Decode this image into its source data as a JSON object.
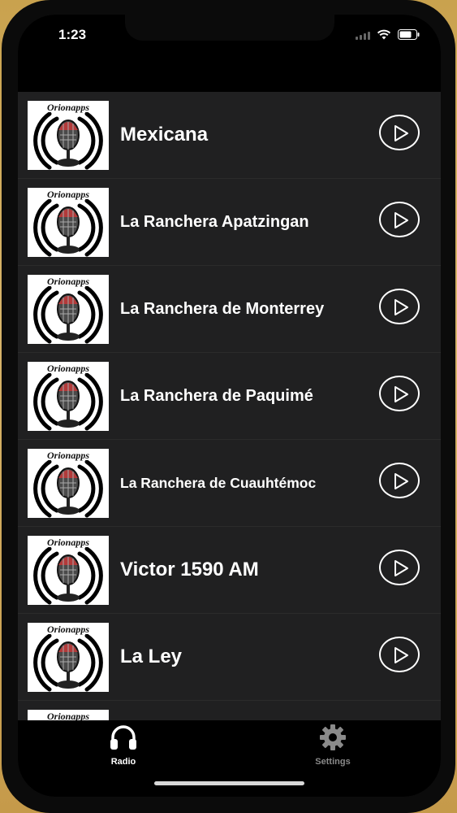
{
  "status": {
    "time": "1:23"
  },
  "thumbnail_brand": "Orionapps",
  "stations": [
    {
      "name": "Mexicana",
      "size": "large"
    },
    {
      "name": "La Ranchera Apatzingan",
      "size": "medium"
    },
    {
      "name": "La Ranchera de Monterrey",
      "size": "medium"
    },
    {
      "name": "La Ranchera de Paquimé",
      "size": "medium"
    },
    {
      "name": "La Ranchera de Cuauhtémoc",
      "size": "small"
    },
    {
      "name": "Victor 1590 AM",
      "size": "large"
    },
    {
      "name": "La Ley",
      "size": "large"
    }
  ],
  "tabs": {
    "radio": {
      "label": "Radio",
      "icon": "headphones-icon",
      "active": true
    },
    "settings": {
      "label": "Settings",
      "icon": "gear-icon",
      "active": false
    }
  },
  "colors": {
    "background": "#202021",
    "bars": "#000000",
    "text": "#ffffff",
    "tab_inactive": "#8a8a8a"
  }
}
